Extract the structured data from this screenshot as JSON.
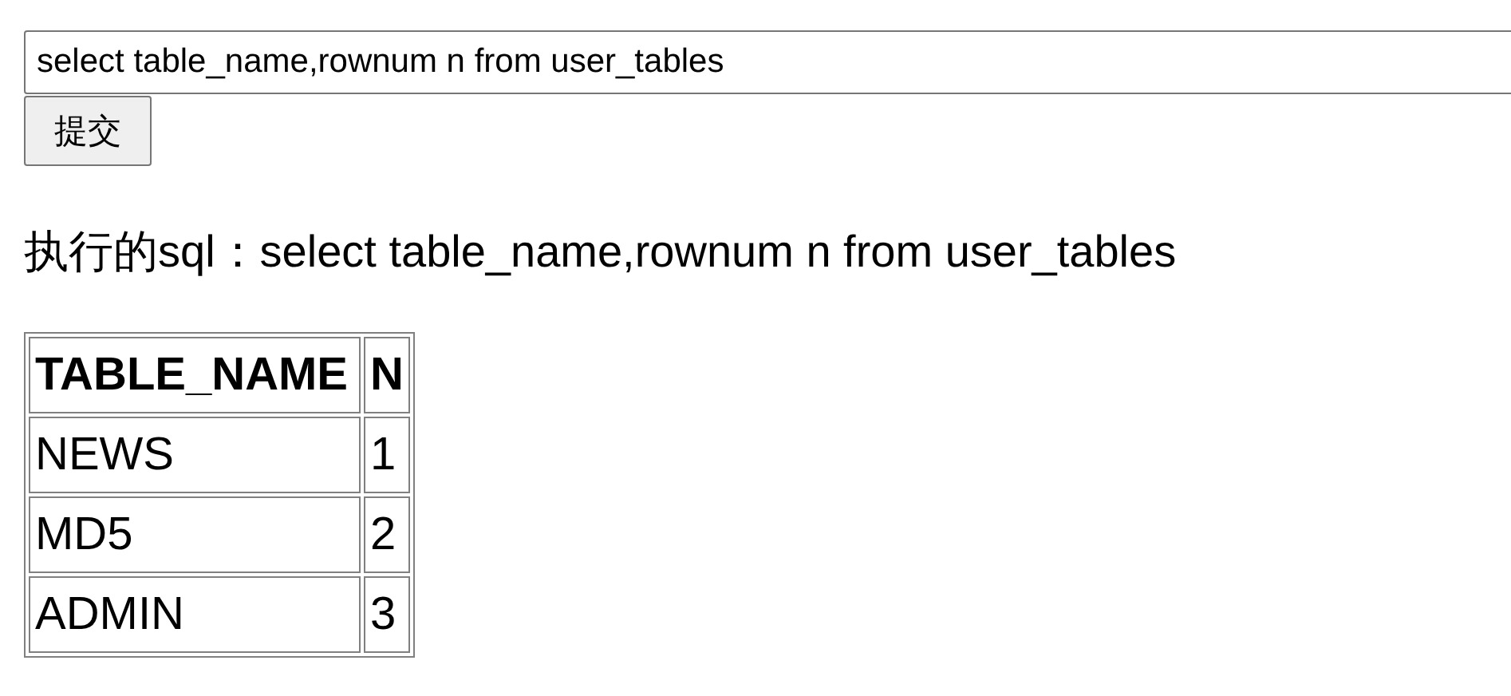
{
  "query_field": {
    "value": "select table_name,rownum n from user_tables"
  },
  "submit_button": {
    "label": "提交"
  },
  "executed_sql": "执行的sql：select table_name,rownum n from user_tables",
  "table": {
    "columns": [
      "TABLE_NAME",
      "N"
    ],
    "rows": [
      [
        "NEWS",
        "1"
      ],
      [
        "MD5",
        "2"
      ],
      [
        "ADMIN",
        "3"
      ]
    ]
  }
}
